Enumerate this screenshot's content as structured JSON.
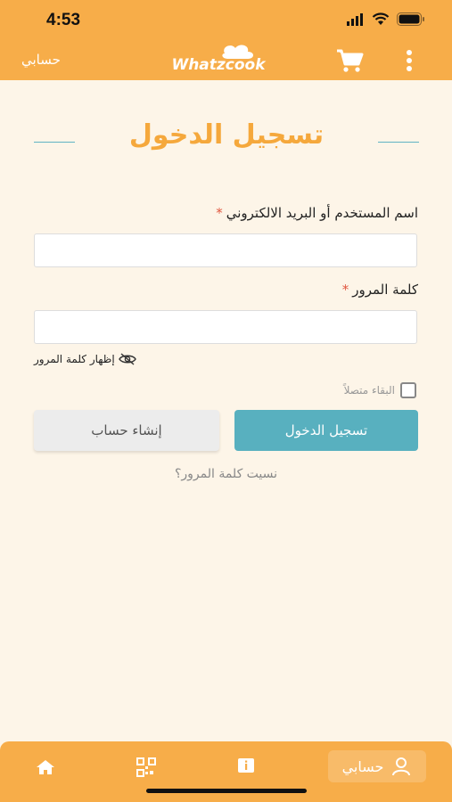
{
  "status_bar": {
    "time": "4:53"
  },
  "header": {
    "account_label": "حسابي",
    "logo_text": "Whatzcook",
    "icons": {
      "cart": "cart-icon",
      "more": "more-vertical-icon"
    }
  },
  "page": {
    "title": "تسجيل الدخول",
    "username_label": "اسم المستخدم أو البريد الالكتروني",
    "username_value": "",
    "password_label": "كلمة المرور",
    "password_value": "",
    "required_mark": "*",
    "show_password_label": "إظهار كلمة المرور",
    "remember_label": "البقاء متصلاً",
    "remember_checked": false,
    "login_button": "تسجيل الدخول",
    "register_button": "إنشاء حساب",
    "forgot_password": "نسيت كلمة المرور؟"
  },
  "bottom_nav": {
    "account_label": "حسابي",
    "items": [
      "home-icon",
      "qr-code-icon",
      "info-icon",
      "user-icon"
    ]
  },
  "colors": {
    "brand": "#f7ad49",
    "accent": "#58b0bf",
    "background": "#fdf5e8",
    "title": "#f5a83c"
  }
}
